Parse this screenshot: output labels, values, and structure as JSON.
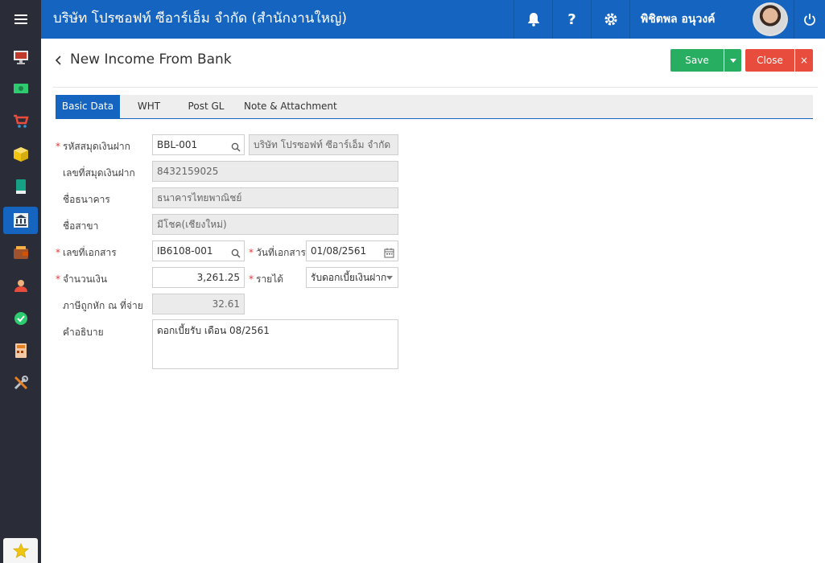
{
  "header": {
    "company_name": "บริษัท โปรซอฟท์ ซีอาร์เอ็ม จำกัด (สำนักงานใหญ่)",
    "user_name": "พิชิตพล อนุวงค์",
    "icons": [
      "bell-icon",
      "help-icon",
      "gear-icon",
      "power-icon"
    ]
  },
  "sidebar": {
    "items": [
      "monitor-icon",
      "money-icon",
      "cart-icon",
      "box-icon",
      "book-icon",
      "bank-icon",
      "wallet-icon",
      "people-icon",
      "check-icon",
      "calculator-icon",
      "tools-icon"
    ],
    "active_item": "bank-icon",
    "bottom_item": "star-icon"
  },
  "page": {
    "title": "New Income From Bank",
    "save_label": "Save",
    "close_label": "Close",
    "close_x": "×"
  },
  "tabs": [
    {
      "label": "Basic Data",
      "active": true
    },
    {
      "label": "WHT",
      "active": false
    },
    {
      "label": "Post GL",
      "active": false
    },
    {
      "label": "Note & Attachment",
      "active": false
    }
  ],
  "form": {
    "bank_book_code": {
      "label": "รหัสสมุดเงินฝาก",
      "required": true,
      "value": "BBL-001",
      "company": "บริษัท โปรซอฟท์ ซีอาร์เอ็ม จำกัด"
    },
    "bank_book_no": {
      "label": "เลขที่สมุดเงินฝาก",
      "value": "8432159025"
    },
    "bank_name": {
      "label": "ชื่อธนาคาร",
      "value": "ธนาคารไทยพาณิชย์"
    },
    "branch_name": {
      "label": "ชื่อสาขา",
      "value": "มีโชค(เชียงใหม่)"
    },
    "doc_no": {
      "label": "เลขที่เอกสาร",
      "required": true,
      "value": "IB6108-001"
    },
    "doc_date": {
      "label": "วันที่เอกสาร",
      "required": true,
      "value": "01/08/2561"
    },
    "amount": {
      "label": "จำนวนเงิน",
      "required": true,
      "value": "3,261.25"
    },
    "income_type": {
      "label": "รายได้",
      "required": true,
      "value": "รับดอกเบี้ยเงินฝาก"
    },
    "wht": {
      "label": "ภาษีถูกหัก ณ ที่จ่าย",
      "value": "32.61"
    },
    "description": {
      "label": "คำอธิบาย",
      "value": "ดอกเบี้ยรับ เดือน 08/2561"
    }
  },
  "colors": {
    "primary": "#1565c0",
    "sidebar": "#2a2d37",
    "save": "#27ae60",
    "close": "#e74c3c"
  }
}
